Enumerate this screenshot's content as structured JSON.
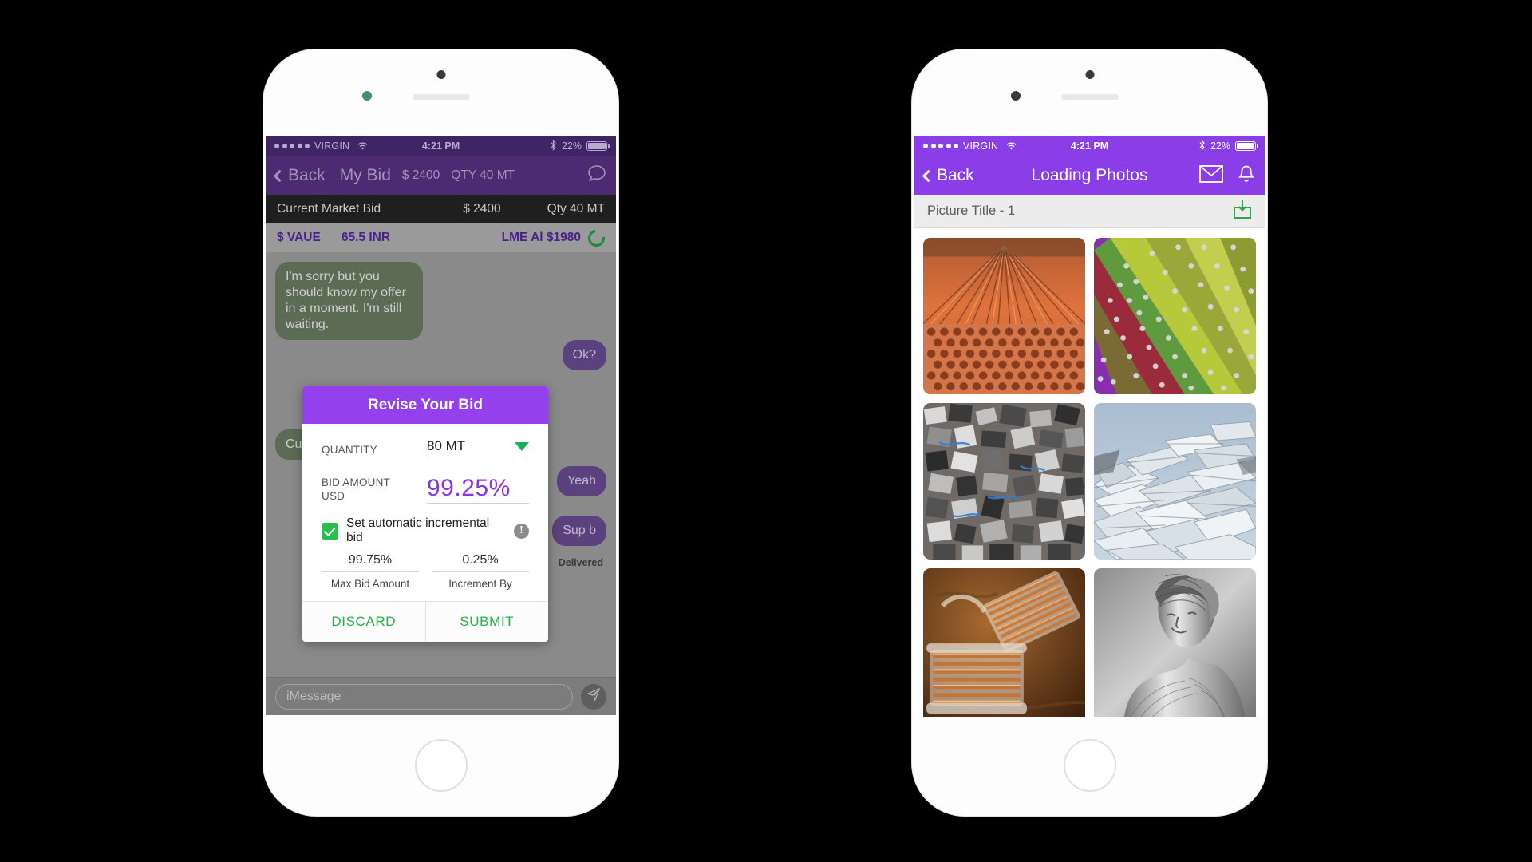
{
  "left_phone": {
    "status_bar": {
      "carrier": "VIRGIN",
      "time": "4:21 PM",
      "battery_pct": "22%",
      "signal_icon": "signal-dots-icon",
      "wifi_icon": "wifi-icon",
      "bluetooth_icon": "bluetooth-icon",
      "battery_icon": "battery-icon"
    },
    "nav": {
      "back_label": "Back",
      "back_icon": "chevron-left-icon",
      "title": "My Bid",
      "price": "$ 2400",
      "qty": "QTY 40 MT",
      "chat_icon": "chat-bubble-icon"
    },
    "market_bar": {
      "label": "Current Market Bid",
      "price": "$ 2400",
      "qty": "Qty 40 MT"
    },
    "lme_bar": {
      "value_label": "$ VAUE",
      "inr": "65.5 INR",
      "lme": "LME Al $1980",
      "refresh_icon": "refresh-circle-icon"
    },
    "chat": {
      "messages": [
        {
          "side": "in",
          "text": "I'm sorry but you should know my offer in a moment. I'm still waiting."
        },
        {
          "side": "out",
          "text": "Ok?"
        },
        {
          "side": "in",
          "text": "Cu 99.5"
        },
        {
          "side": "out",
          "text": "Yeah"
        },
        {
          "side": "out",
          "text": "Sup b"
        }
      ],
      "delivered_label": "Delivered"
    },
    "composer": {
      "placeholder": "iMessage",
      "value": "",
      "send_icon": "send-paper-plane-icon"
    },
    "modal": {
      "title": "Revise Your Bid",
      "quantity_label": "QUANTITY",
      "quantity_value": "80 MT",
      "quantity_caret_icon": "caret-down-icon",
      "bid_amount_label": "BID AMOUNT\nUSD",
      "bid_amount_label_line1": "BID AMOUNT",
      "bid_amount_label_line2": "USD",
      "bid_amount_value": "99.25%",
      "checkbox_label": "Set automatic incremental bid",
      "checkbox_checked": true,
      "checkbox_icon": "checkbox-checked-icon",
      "info_icon": "info-exclamation-icon",
      "max_bid_value": "99.75%",
      "max_bid_label": "Max Bid Amount",
      "increment_value": "0.25%",
      "increment_label": "Increment By",
      "discard_label": "DISCARD",
      "submit_label": "SUBMIT"
    }
  },
  "right_phone": {
    "status_bar": {
      "carrier": "VIRGIN",
      "time": "4:21 PM",
      "battery_pct": "22%",
      "signal_icon": "signal-dots-icon",
      "wifi_icon": "wifi-icon",
      "bluetooth_icon": "bluetooth-icon",
      "battery_icon": "battery-icon"
    },
    "nav": {
      "back_label": "Back",
      "back_icon": "chevron-left-icon",
      "title": "Loading Photos",
      "mail_icon": "envelope-icon",
      "bell_icon": "bell-icon"
    },
    "subbar": {
      "title": "Picture Title - 1",
      "download_icon": "download-box-icon"
    },
    "photos": [
      {
        "name": "copper-tubes-photo",
        "alt": "Bundle of copper tubes"
      },
      {
        "name": "colored-metal-strips-photo",
        "alt": "Colorful studded metal strips"
      },
      {
        "name": "electronic-scrap-photo",
        "alt": "Pile of electronic scrap"
      },
      {
        "name": "aluminium-scrap-photo",
        "alt": "Aluminium extrusion scrap pile"
      },
      {
        "name": "copper-wire-spool-photo",
        "alt": "Spools of copper wire"
      },
      {
        "name": "aluminium-sculpture-photo",
        "alt": "Silver metal bust sculpture"
      }
    ]
  },
  "colors": {
    "brand_purple": "#8b3ee8",
    "modal_purple": "#9440ec",
    "dim_purple": "#4c2b73",
    "accent_green": "#24b14b",
    "bid_purple": "#8a35e0",
    "background": "#000000"
  }
}
